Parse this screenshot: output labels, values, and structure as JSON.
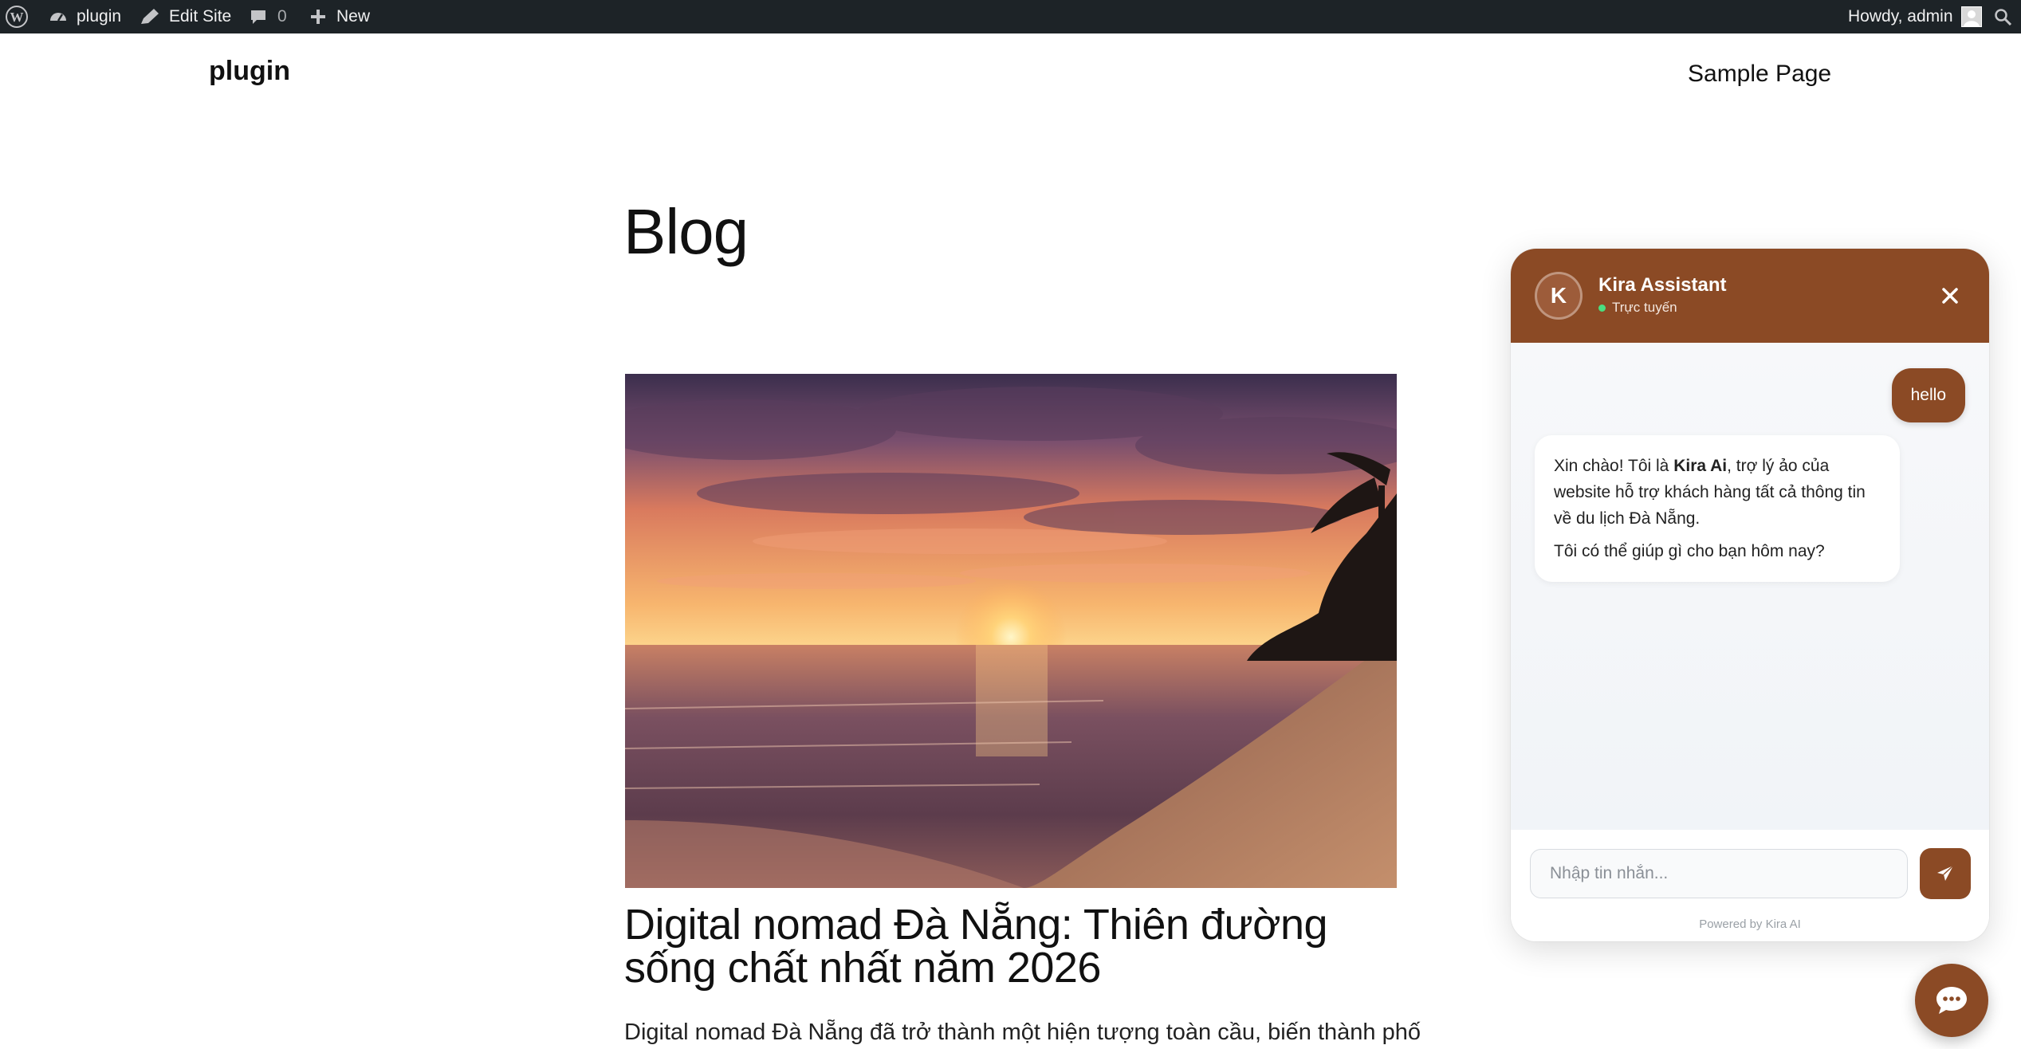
{
  "admin_bar": {
    "site_name": "plugin",
    "edit_site_label": "Edit Site",
    "comments_count": "0",
    "new_label": "New",
    "greeting": "Howdy, admin",
    "icons": [
      "wordpress-icon",
      "dashboard-icon",
      "edit-pencil-icon",
      "comment-icon",
      "plus-icon",
      "avatar-icon",
      "search-icon"
    ]
  },
  "site": {
    "title": "plugin",
    "nav": [
      "Sample Page"
    ]
  },
  "main": {
    "heading": "Blog",
    "post": {
      "image_alt": "Sunset over the beach",
      "title": "Digital nomad Đà Nẵng: Thiên đường sống chất nhất năm 2026",
      "excerpt": "Digital nomad Đà Nẵng đã trở thành một hiện tượng toàn cầu, biến thành phố"
    }
  },
  "chat": {
    "avatar_initial": "K",
    "name": "Kira Assistant",
    "status": "Trực tuyến",
    "status_color": "#4ade80",
    "accent_color": "#8b4a25",
    "messages": {
      "user": "hello",
      "bot_intro": "Xin chào! Tôi là ",
      "bot_name": "Kira Ai",
      "bot_rest": ", trợ lý ảo của website hỗ trợ khách hàng tất cả thông tin về du lịch Đà Nẵng.",
      "bot_question": "Tôi có thể giúp gì cho bạn hôm nay?"
    },
    "input_placeholder": "Nhập tin nhắn...",
    "powered_by": "Powered by Kira AI"
  }
}
